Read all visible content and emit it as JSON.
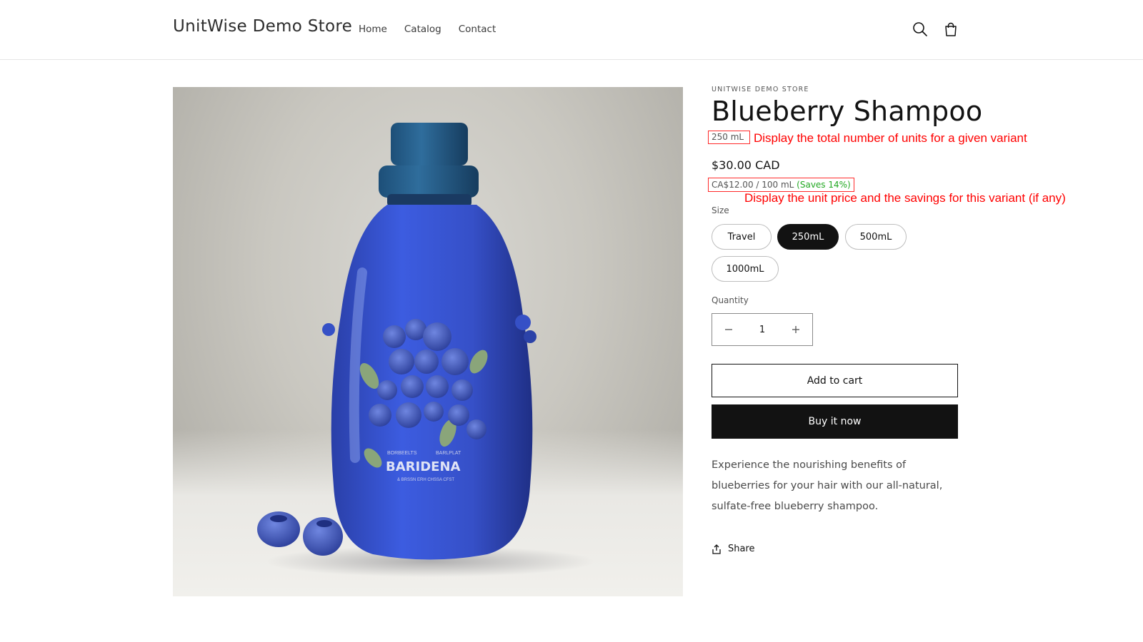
{
  "header": {
    "store_name": "UnitWise Demo Store",
    "nav": [
      "Home",
      "Catalog",
      "Contact"
    ]
  },
  "product": {
    "vendor": "UNITWISE DEMO STORE",
    "title": "Blueberry Shampoo",
    "units": "250 mL",
    "price": "$30.00 CAD",
    "unit_price": "CA$12.00 / 100 mL",
    "savings": "(Saves 14%)",
    "size_label": "Size",
    "variants": [
      "Travel",
      "250mL",
      "500mL",
      "1000mL"
    ],
    "selected_variant": "250mL",
    "quantity_label": "Quantity",
    "quantity_value": "1",
    "add_to_cart": "Add to cart",
    "buy_now": "Buy it now",
    "description": "Experience the nourishing benefits of blueberries for your hair with our all-natural, sulfate-free blueberry shampoo.",
    "share": "Share",
    "bottle_label_line1": "BARIDENA",
    "bottle_label_top_left": "BORBEELTS",
    "bottle_label_top_right": "BARLPLAT",
    "bottle_label_bottom": "& BRSSN ERH CHSSA CFST"
  },
  "annotations": {
    "units_note": "Display the total number of units for a given variant",
    "unit_price_note": "Display the unit price and the savings for this variant (if any)"
  },
  "icons": [
    "search-icon",
    "cart-icon",
    "minus-icon",
    "plus-icon",
    "share-icon"
  ],
  "colors": {
    "accent": "#121212",
    "annotation": "#ff0000",
    "savings": "#22a822",
    "bottle": "#2f4fbf"
  }
}
